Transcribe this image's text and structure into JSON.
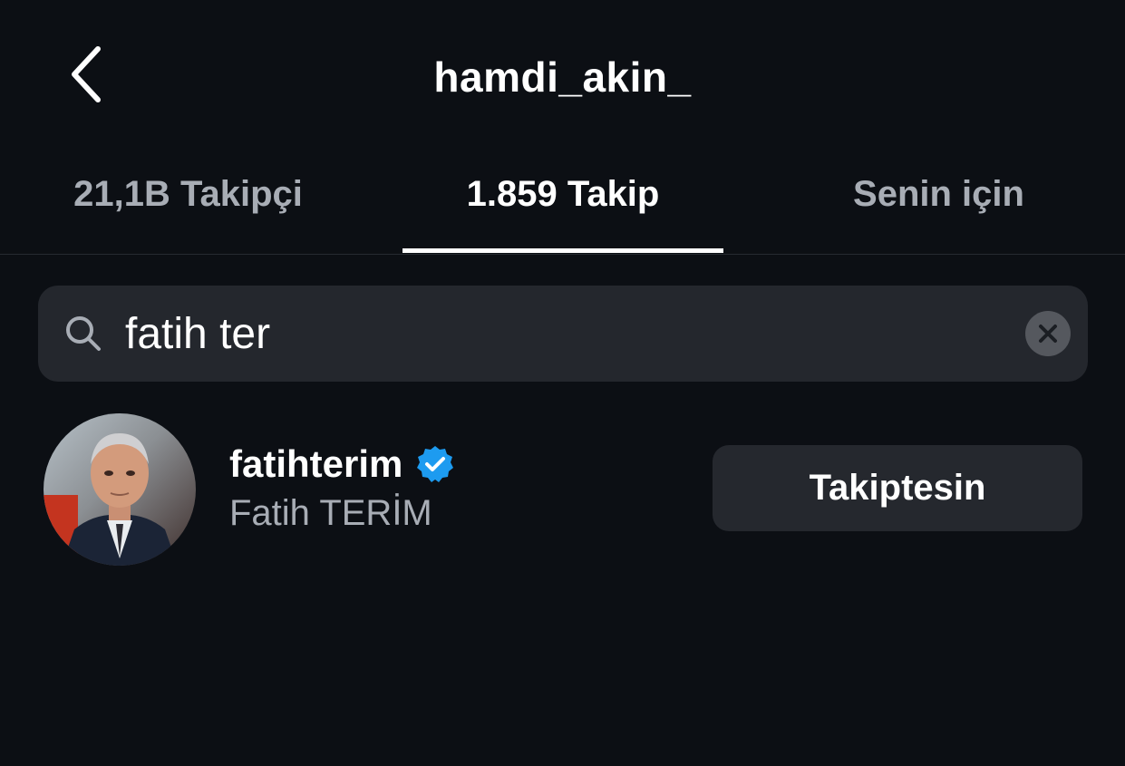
{
  "header": {
    "title": "hamdi_akin_",
    "back_icon": "chevron-left-icon"
  },
  "tabs": [
    {
      "label": "21,1B Takipçi",
      "active": false
    },
    {
      "label": "1.859 Takip",
      "active": true
    },
    {
      "label": "Senin için",
      "active": false
    }
  ],
  "search": {
    "value": "fatih ter",
    "placeholder": "",
    "icon": "search-icon",
    "clear_icon": "close-icon"
  },
  "results": [
    {
      "username": "fatihterim",
      "verified": true,
      "full_name": "Fatih TERİM",
      "button_label": "Takiptesin"
    }
  ],
  "colors": {
    "background": "#0c0f14",
    "surface": "#24272d",
    "text_primary": "#ffffff",
    "text_secondary": "#a8adb5",
    "verified_blue": "#1d9bf0"
  }
}
